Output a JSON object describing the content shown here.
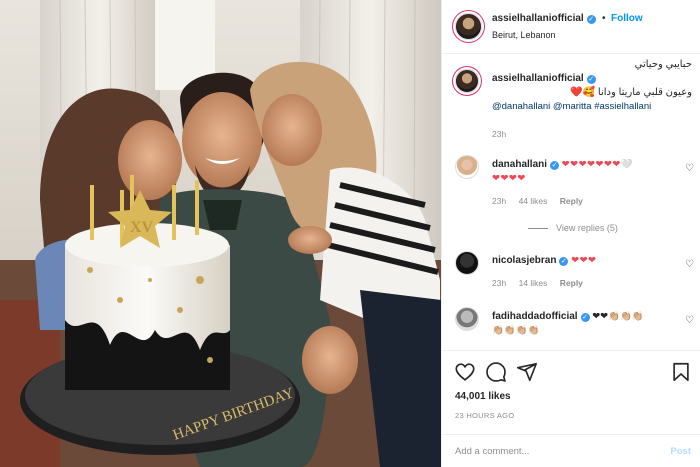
{
  "colors": {
    "accent": "#0095f6",
    "verified": "#3897f0",
    "heart": "#ed4956",
    "muted": "#8e8e8e"
  },
  "photo": {
    "cake_topper_text": "XV",
    "cake_board_text": "HAPPY BIRTHDAY",
    "description_icon": "photo"
  },
  "header": {
    "username": "assielhallaniofficial",
    "separator": "•",
    "follow_label": "Follow",
    "location": "Beirut, Lebanon"
  },
  "caption": {
    "username": "assielhallaniofficial",
    "line1": "حبايبي وحياتي",
    "line2": "وعيون قلبي ماريتا ودانا 🥰❤️",
    "mentions": "@danahallani @maritta #assielhallani",
    "time": "23h"
  },
  "comments": [
    {
      "username": "danahallani",
      "text_line1": "❤❤❤❤❤❤❤🤍",
      "text_line2": "❤❤❤❤",
      "time": "23h",
      "likes": "44 likes",
      "reply": "Reply",
      "view_replies": "View replies (5)"
    },
    {
      "username": "nicolasjebran",
      "text_line1": "❤❤❤",
      "time": "23h",
      "likes": "14 likes",
      "reply": "Reply"
    },
    {
      "username": "fadihaddadofficial",
      "text_line1": "❤❤👏🏼👏🏼👏🏼",
      "text_line2": "👏🏼👏🏼👏🏼👏🏼"
    }
  ],
  "actions": {
    "likes": "44,001 likes",
    "timestamp": "23 HOURS AGO",
    "add_comment_placeholder": "Add a comment...",
    "post_label": "Post"
  }
}
